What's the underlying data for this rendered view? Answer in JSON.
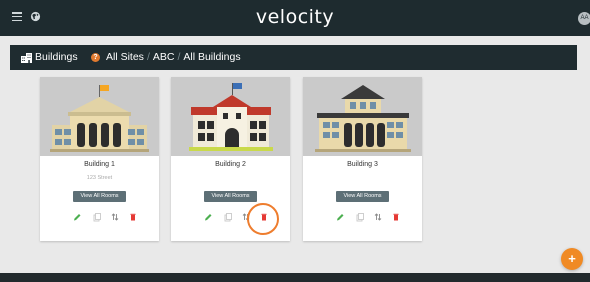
{
  "app": {
    "logo": "velocity",
    "avatar_initials": "AA"
  },
  "breadcrumb": {
    "title": "Buildings",
    "items": [
      "All Sites",
      "ABC",
      "All Buildings"
    ]
  },
  "buildings": [
    {
      "name": "Building 1",
      "address": "123 Street",
      "view_label": "View All Rooms"
    },
    {
      "name": "Building 2",
      "address": "",
      "view_label": "View All Rooms"
    },
    {
      "name": "Building 3",
      "address": "",
      "view_label": "View All Rooms"
    }
  ],
  "fab_label": "+",
  "colors": {
    "topbar": "#1e2b2f",
    "accent_orange": "#f08a24",
    "edit_green": "#4caf50",
    "delete_red": "#e53935",
    "button_slate": "#5d6f76"
  },
  "icons": [
    "menu-icon",
    "globe-icon",
    "building-icon",
    "help-icon",
    "edit-icon",
    "copy-icon",
    "sort-icon",
    "delete-icon",
    "plus-icon"
  ]
}
